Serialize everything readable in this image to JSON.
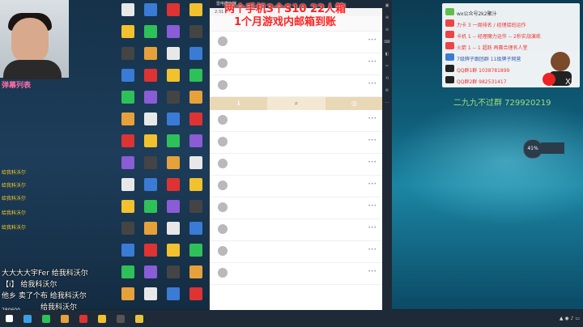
{
  "overlay": {
    "line1": "两个手机3个S10 22人箱",
    "line2": "1个月游戏内邮箱到账"
  },
  "danmaku": {
    "title": "弹幕列表",
    "lines": [
      "给我科沃尔",
      "给我科沃尔",
      "给我科沃尔",
      "给我科沃尔",
      "给我科沃尔"
    ],
    "big": [
      "大大大大宇Fer 给我科沃尔",
      "【i】 给我科沃尔",
      "他乡 卖了个布 给我科沃尔",
      "给我科沃尔"
    ],
    "footer": "780600"
  },
  "emulator": {
    "title": "雷电模拟器",
    "statusbar": "2:31"
  },
  "info_panel": {
    "lines": [
      "wx公众号2k2聚汁",
      "力卡 3 一周排名 / 经理接班运作",
      "卡机 1 -- 经理魔力运作 -- 2秒实战演练",
      "火箭 1 -- 1 超跃 再赛合理名人堂",
      "7级牌子跟团群 11级牌子网营",
      "QQ群1群 1038781899",
      "QQ群2群 982531417"
    ],
    "qq_large": "二九九不过群  729920219"
  },
  "speed": {
    "value": "41",
    "unit": "%"
  },
  "taskbar": {
    "items": [
      "",
      "",
      "",
      "",
      "",
      "",
      "",
      ""
    ]
  }
}
